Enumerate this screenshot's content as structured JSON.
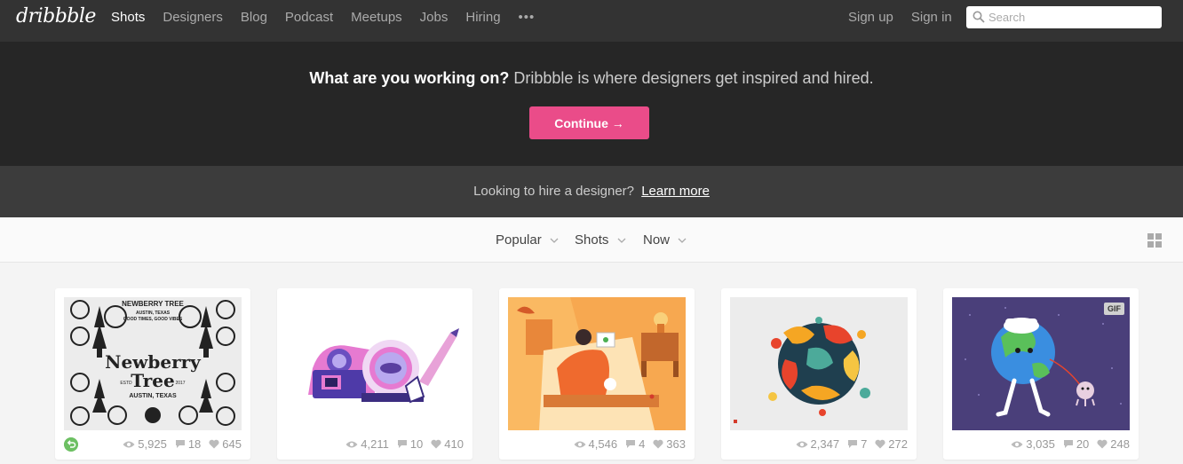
{
  "nav": {
    "logo": "dribbble",
    "links": [
      "Shots",
      "Designers",
      "Blog",
      "Podcast",
      "Meetups",
      "Jobs",
      "Hiring"
    ],
    "more": "•••",
    "signup": "Sign up",
    "signin": "Sign in",
    "search_placeholder": "Search"
  },
  "hero": {
    "question": "What are you working on?",
    "tagline": " Dribbble is where designers get inspired and hired.",
    "cta": "Continue →"
  },
  "hire": {
    "text": "Looking to hire a designer?",
    "link": "Learn more"
  },
  "filters": {
    "sort": "Popular",
    "type": "Shots",
    "time": "Now"
  },
  "shots": [
    {
      "views": "5,925",
      "comments": "18",
      "likes": "645",
      "rebound": true,
      "gif": false
    },
    {
      "views": "4,211",
      "comments": "10",
      "likes": "410",
      "rebound": false,
      "gif": false
    },
    {
      "views": "4,546",
      "comments": "4",
      "likes": "363",
      "rebound": false,
      "gif": false
    },
    {
      "views": "2,347",
      "comments": "7",
      "likes": "272",
      "rebound": false,
      "gif": false
    },
    {
      "views": "3,035",
      "comments": "20",
      "likes": "248",
      "rebound": false,
      "gif": true,
      "gif_label": "GIF"
    }
  ],
  "shot1": {
    "line1": "NEWBERRY TREE",
    "line2": "AUSTIN, TEXAS",
    "line3": "GOOD TIMES, GOOD VIBES",
    "title1": "Newberry",
    "title2": "Tree",
    "estd": "ESTD",
    "year": "2017",
    "city": "AUSTIN, TEXAS"
  },
  "colors": {
    "nav_bg": "#333333",
    "hero_bg": "#262626",
    "hire_bg": "#3c3c3c",
    "brand_pink": "#ea4c89",
    "rebound_green": "#6dc063"
  }
}
